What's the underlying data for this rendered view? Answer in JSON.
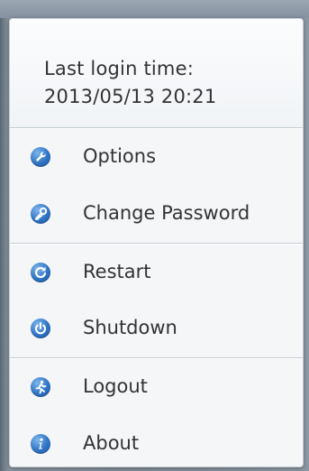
{
  "login": {
    "label": "Last login time:",
    "value": "2013/05/13 20:21"
  },
  "menu": {
    "options": "Options",
    "change_password": "Change Password",
    "restart": "Restart",
    "shutdown": "Shutdown",
    "logout": "Logout",
    "about": "About"
  },
  "icons": {
    "options": "wrench-icon",
    "change_password": "key-icon",
    "restart": "restart-icon",
    "shutdown": "power-icon",
    "logout": "running-person-icon",
    "about": "info-icon"
  },
  "colors": {
    "accent": "#2f74c4",
    "text": "#333333",
    "popup_bg": "#f4f6f8"
  }
}
